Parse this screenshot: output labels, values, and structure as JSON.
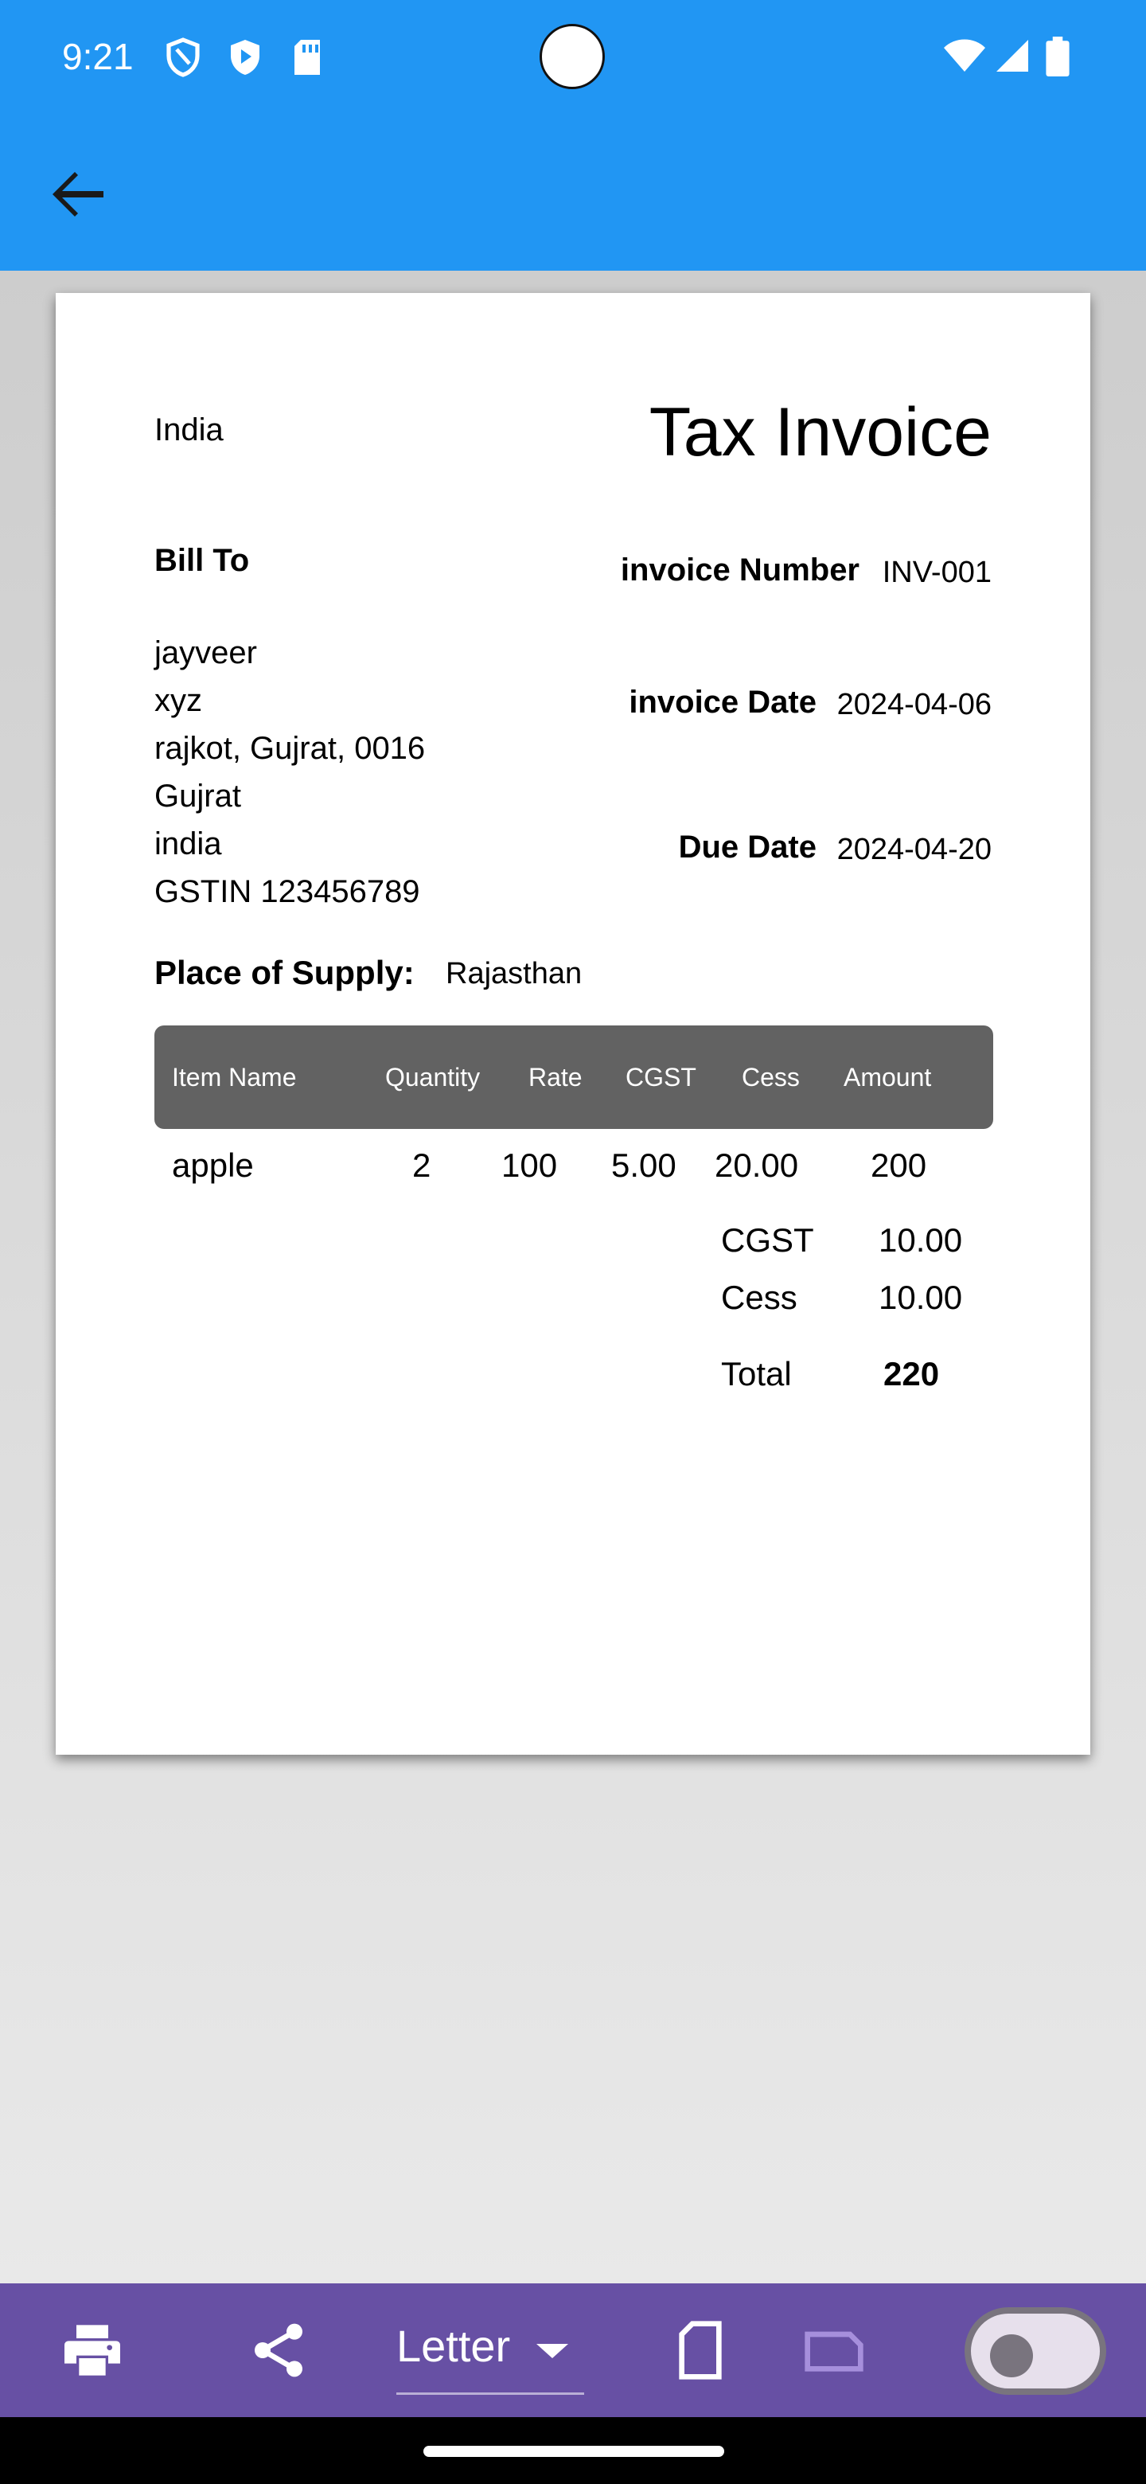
{
  "status_bar": {
    "time": "9:21"
  },
  "invoice": {
    "country": "India",
    "title": "Tax Invoice",
    "bill_to_label": "Bill To",
    "address_lines": [
      "jayveer",
      "xyz",
      "rajkot, Gujrat, 0016",
      "Gujrat",
      "india",
      "GSTIN 123456789"
    ],
    "invoice_number_label": "invoice Number",
    "invoice_number": "INV-001",
    "invoice_date_label": "invoice Date",
    "invoice_date": "2024-04-06",
    "due_date_label": "Due Date",
    "due_date": "2024-04-20",
    "place_of_supply_label": "Place of Supply:",
    "place_of_supply": "Rajasthan",
    "columns": [
      "Item Name",
      "Quantity",
      "Rate",
      "CGST",
      "Cess",
      "Amount"
    ],
    "rows": [
      {
        "item": "apple",
        "quantity": "2",
        "rate": "100",
        "cgst": "5.00",
        "cess": "20.00",
        "amount": "200"
      }
    ],
    "summary": {
      "cgst_label": "CGST",
      "cgst_value": "10.00",
      "cess_label": "Cess",
      "cess_value": "10.00",
      "total_label": "Total",
      "total_value": "220"
    }
  },
  "toolbar": {
    "paper_size": "Letter",
    "toggle_on": false
  },
  "colors": {
    "app_bar": "#2196f3",
    "toolbar": "#6750a4",
    "table_header": "#626262"
  }
}
